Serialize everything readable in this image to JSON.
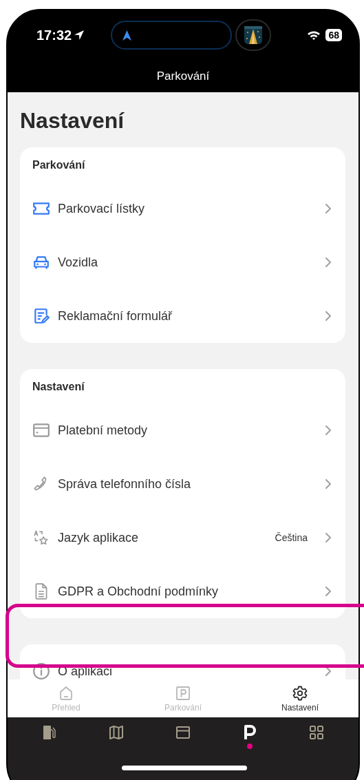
{
  "status_bar": {
    "time": "17:32",
    "battery": "68"
  },
  "nav_bar": {
    "title": "Parkování"
  },
  "heading": "Nastavení",
  "sections": [
    {
      "title": "Parkování",
      "color": "#3478f6",
      "items": [
        {
          "label": "Parkovací lístky",
          "kind": "ticket"
        },
        {
          "label": "Vozidla",
          "kind": "car"
        },
        {
          "label": "Reklamační formulář",
          "kind": "form"
        }
      ]
    },
    {
      "title": "Nastavení",
      "color": "#9a9a9a",
      "items": [
        {
          "label": "Platební metody",
          "kind": "card"
        },
        {
          "label": "Správa telefonního čísla",
          "kind": "phone"
        },
        {
          "label": "Jazyk aplikace",
          "kind": "translate",
          "value": "Čeština"
        },
        {
          "label": "GDPR a Obchodní podmínky",
          "kind": "document"
        }
      ]
    },
    {
      "color": "#9a9a9a",
      "items": [
        {
          "label": "O aplikaci",
          "kind": "info"
        }
      ]
    }
  ],
  "tab_bar": [
    {
      "label": "Přehled",
      "kind": "home",
      "selected": false
    },
    {
      "label": "Parkování",
      "kind": "parking",
      "selected": false
    },
    {
      "label": "Nastavení",
      "kind": "gear",
      "selected": true
    }
  ],
  "app_nav": [
    {
      "kind": "fuel",
      "selected": false
    },
    {
      "kind": "map",
      "selected": false
    },
    {
      "kind": "card",
      "selected": false
    },
    {
      "kind": "p",
      "selected": true
    },
    {
      "kind": "grid",
      "selected": false
    }
  ]
}
